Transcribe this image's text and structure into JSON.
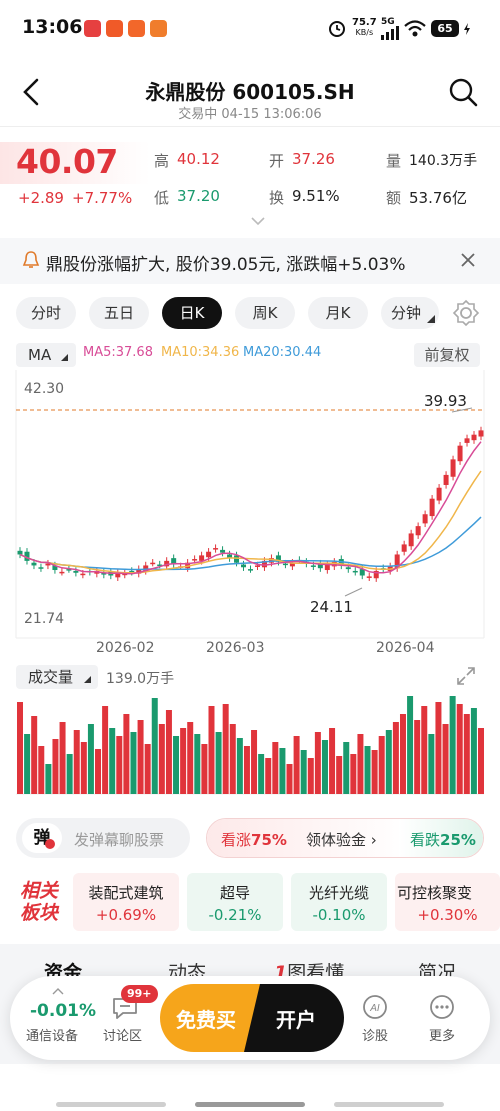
{
  "status_bar": {
    "time": "13:06",
    "speed": "75.7",
    "speed_unit": "KB/s",
    "net": "5G",
    "battery": "65"
  },
  "header": {
    "title": "永鼎股份 600105.SH",
    "subtitle": "交易中 04-15 13:06:06"
  },
  "quote": {
    "price": "40.07",
    "change": "+2.89",
    "change_pct": "+7.77%",
    "high_label": "高",
    "high": "40.12",
    "low_label": "低",
    "low": "37.20",
    "open_label": "开",
    "open": "37.26",
    "turnover_label": "换",
    "turnover": "9.51%",
    "volume_label": "量",
    "volume": "140.3万手",
    "amount_label": "额",
    "amount": "53.76亿"
  },
  "ticker": {
    "text": "鼎股份涨幅扩大, 股价39.05元, 涨跌幅+5.03%"
  },
  "chart_tabs": [
    {
      "label": "分时"
    },
    {
      "label": "五日"
    },
    {
      "label": "日K"
    },
    {
      "label": "周K"
    },
    {
      "label": "月K"
    },
    {
      "label": "分钟"
    }
  ],
  "ma": {
    "button": "MA",
    "ma5": "MA5:37.68",
    "ma10": "MA10:34.36",
    "ma20": "MA20:30.44",
    "adjust": "前复权"
  },
  "chart_labels": {
    "y_max": "42.30",
    "y_min": "21.74",
    "high_mark": "39.93",
    "low_mark": "24.11",
    "x1": "2026-02",
    "x2": "2026-03",
    "x3": "2026-04"
  },
  "volume": {
    "button": "成交量",
    "value": "139.0万手"
  },
  "colors": {
    "up": "#e0343b",
    "down": "#1a9a6e",
    "ma5": "#d84c97",
    "ma10": "#f0b64a",
    "ma20": "#3f9bd9"
  },
  "danmu": {
    "badge": "弹",
    "placeholder": "发弹幕聊股票"
  },
  "vote": {
    "up_label": "看涨",
    "up_pct": "75%",
    "middle": "领体验金",
    "down_label": "看跌",
    "down_pct": "25%"
  },
  "sectors": {
    "title_line1": "相关",
    "title_line2": "板块",
    "items": [
      {
        "name": "装配式建筑",
        "change": "+0.69%"
      },
      {
        "name": "超导",
        "change": "-0.21%"
      },
      {
        "name": "光纤光缆",
        "change": "-0.10%"
      },
      {
        "name": "可控核聚变",
        "change": "+0.30%"
      }
    ]
  },
  "section_tabs": [
    {
      "label": "资金"
    },
    {
      "label": "动态"
    },
    {
      "label": "图看懂"
    },
    {
      "label": "简况"
    }
  ],
  "bottom_nav": {
    "index_value": "-0.01%",
    "index_name": "通信设备",
    "discuss_badge": "99+",
    "discuss_label": "讨论区",
    "buy_label": "免费买",
    "open_label": "开户",
    "diagnose_label": "诊股",
    "more_label": "更多"
  }
}
